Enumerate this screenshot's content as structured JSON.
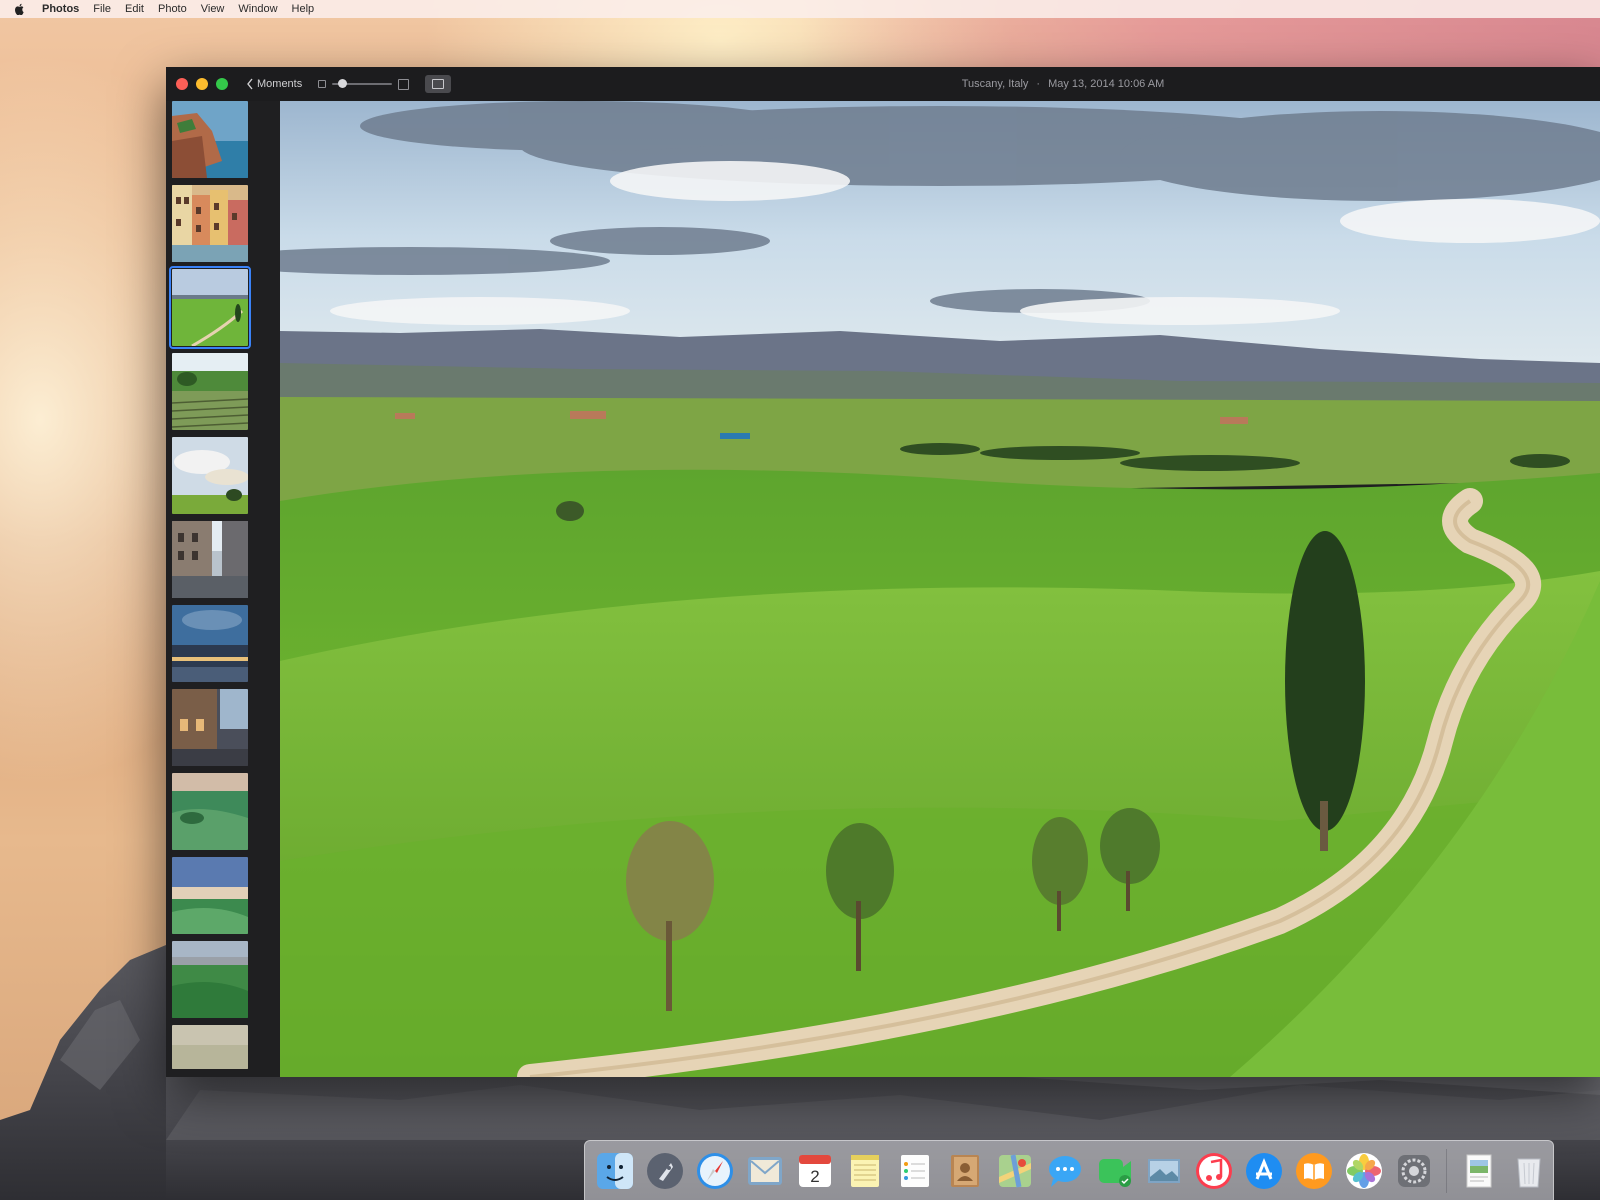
{
  "menubar": {
    "apple_icon": "apple-logo-icon",
    "app_name": "Photos",
    "menus": [
      "File",
      "Edit",
      "Photo",
      "View",
      "Window",
      "Help"
    ]
  },
  "window": {
    "back_label": "Moments",
    "location": "Tuscany, Italy",
    "date": "May 13, 2014  10:06 AM",
    "zoom_level": 0.1,
    "selected_thumbnail_index": 2,
    "thumbnail_count": 12
  },
  "dock": {
    "apps": [
      {
        "name": "Finder",
        "icon": "finder-icon"
      },
      {
        "name": "Launchpad",
        "icon": "launchpad-icon"
      },
      {
        "name": "Safari",
        "icon": "safari-icon"
      },
      {
        "name": "Mail",
        "icon": "mail-icon"
      },
      {
        "name": "Calendar",
        "icon": "calendar-icon",
        "badge_text": "2"
      },
      {
        "name": "Notes",
        "icon": "notes-icon"
      },
      {
        "name": "Reminders",
        "icon": "reminders-icon"
      },
      {
        "name": "Contacts",
        "icon": "contacts-icon"
      },
      {
        "name": "Maps",
        "icon": "maps-icon"
      },
      {
        "name": "Messages",
        "icon": "messages-icon"
      },
      {
        "name": "FaceTime",
        "icon": "facetime-icon"
      },
      {
        "name": "iPhoto",
        "icon": "iphoto-icon"
      },
      {
        "name": "iTunes",
        "icon": "itunes-icon"
      },
      {
        "name": "App Store",
        "icon": "app-store-icon"
      },
      {
        "name": "iBooks",
        "icon": "ibooks-icon"
      },
      {
        "name": "Photos",
        "icon": "photos-icon"
      },
      {
        "name": "System Preferences",
        "icon": "system-preferences-icon"
      },
      {
        "name": "Preview",
        "icon": "preview-icon"
      },
      {
        "name": "Trash",
        "icon": "trash-icon"
      }
    ]
  },
  "colors": {
    "window_bg": "#1f1f21",
    "selection": "#3a82f7",
    "close": "#fc5f57",
    "minimize": "#fdbc2e",
    "maximize": "#34c84a"
  }
}
